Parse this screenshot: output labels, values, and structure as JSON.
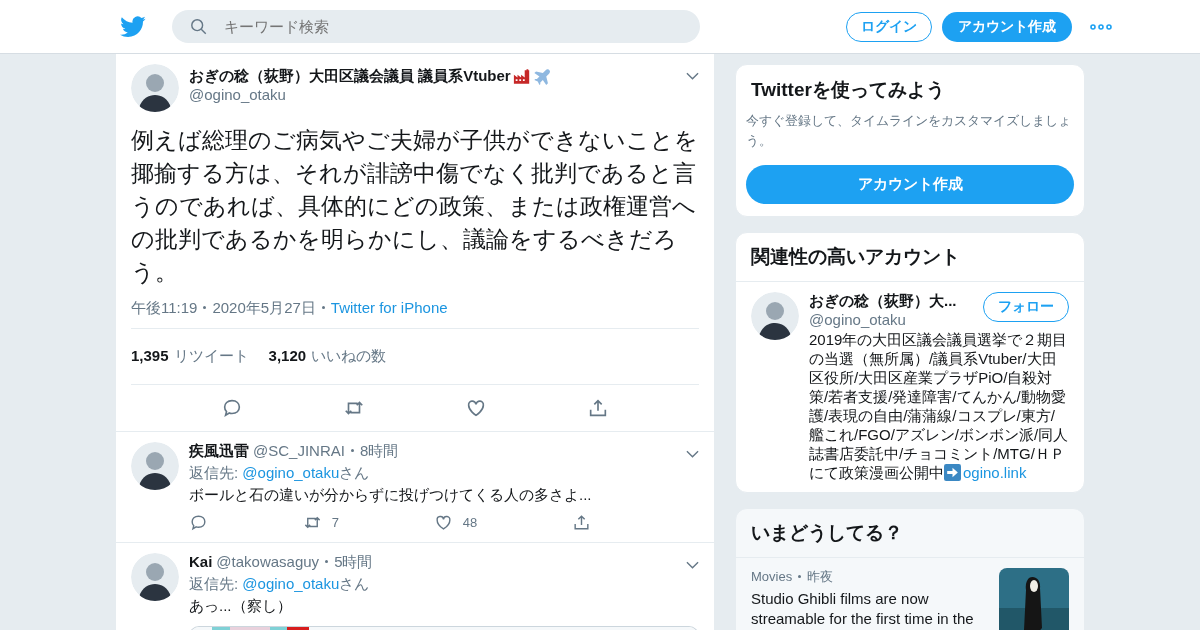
{
  "header": {
    "search": {
      "placeholder": "キーワード検索"
    },
    "login": "ログイン",
    "signup": "アカウント作成"
  },
  "tweet": {
    "name": "おぎの稔（荻野）大田区議会議員 議員系Vtuber",
    "handle": "@ogino_otaku",
    "text": "例えば総理のご病気やご夫婦が子供ができないことを揶揄する方は、それが誹謗中傷でなく批判であると言うのであれば、具体的にどの政策、または政権運営への批判であるかを明らかにし、議論をするべきだろう。",
    "time": "午後11:19",
    "date": "2020年5月27日",
    "source": "Twitter for iPhone",
    "stats": [
      {
        "count": "1,395",
        "label": "リツイート"
      },
      {
        "count": "3,120",
        "label": "いいねの数"
      }
    ]
  },
  "replies": [
    {
      "name": "疾風迅雷",
      "handle": "@SC_JINRAI",
      "time": "8時間",
      "reply_prefix": "返信先:",
      "reply_to": "@ogino_otaku",
      "reply_suffix": "さん",
      "text": "ボールと石の違いが分からずに投げつけてくる人の多さよ...",
      "retweets": "7",
      "likes": "48",
      "media": false
    },
    {
      "name": "Kai",
      "handle": "@takowasaguy",
      "time": "5時間",
      "reply_prefix": "返信先:",
      "reply_to": "@ogino_otaku",
      "reply_suffix": "さん",
      "text": "あっ...（察し）",
      "media": true
    }
  ],
  "signup_card": {
    "title": "Twitterを使ってみよう",
    "text": "今すぐ登録して、タイムラインをカスタマイズしましょう。",
    "button": "アカウント作成"
  },
  "related": {
    "title": "関連性の高いアカウント",
    "accounts": [
      {
        "name": "おぎの稔（荻野）大...",
        "handle": "@ogino_otaku",
        "follow": "フォロー",
        "bio": "2019年の大田区議会議員選挙で２期目の当選（無所属）/議員系Vtuber/大田区役所/大田区産業プラザPiO/自殺対策/若者支援/発達障害/てんかん/動物愛護/表現の自由/蒲蒲線/コスプレ/東方/艦これ/FGO/アズレン/ボンボン派/同人誌書店委託中/チョコミント/MTG/ＨＰにて政策漫画公開中",
        "link": "ogino.link"
      }
    ]
  },
  "trends": {
    "title": "いまどうしてる？",
    "items": [
      {
        "category": "Movies",
        "time": "昨夜",
        "text": "Studio Ghibli films are now streamable for the first time in the",
        "kind": "picture"
      }
    ]
  }
}
